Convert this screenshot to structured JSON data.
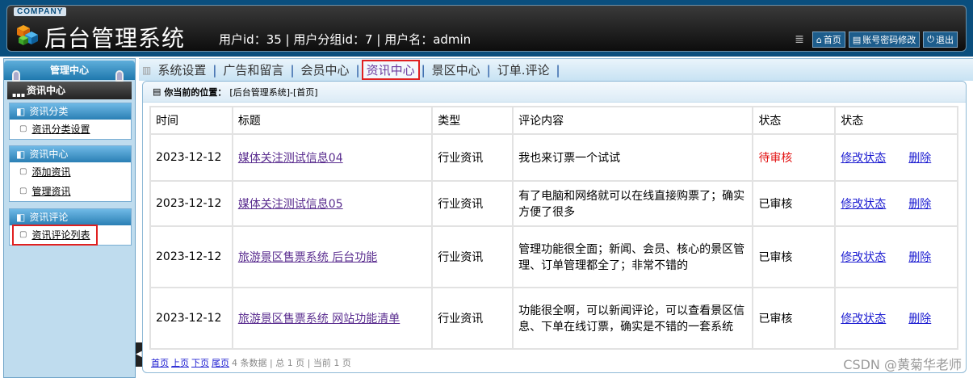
{
  "header": {
    "company": "COMPANY",
    "title": "后台管理系统",
    "user_info": "用户id：35 | 用户分组id：7 | 用户名：admin",
    "links": [
      {
        "label": "首页",
        "icon": "home-icon"
      },
      {
        "label": "账号密码修改",
        "icon": "document-icon"
      },
      {
        "label": "退出",
        "icon": "power-icon"
      }
    ]
  },
  "sidebar": {
    "head": "管理中心",
    "current": "资讯中心",
    "groups": [
      {
        "title": "资讯分类",
        "items": [
          "资讯分类设置"
        ]
      },
      {
        "title": "资讯中心",
        "items": [
          "添加资讯",
          "管理资讯"
        ]
      },
      {
        "title": "资讯评论",
        "items": [
          "资讯评论列表"
        ]
      }
    ]
  },
  "nav": {
    "tabs": [
      "系统设置",
      "广告和留言",
      "会员中心",
      "资讯中心",
      "景区中心",
      "订单.评论"
    ],
    "active_index": 3
  },
  "breadcrumb": {
    "label": "你当前的位置：",
    "path": "[后台管理系统]-[首页]"
  },
  "table": {
    "headers": [
      "时间",
      "标题",
      "类型",
      "评论内容",
      "状态",
      "状态"
    ],
    "rows": [
      {
        "time": "2023-12-12",
        "title": "媒体关注测试信息04",
        "type": "行业资讯",
        "comment": "我也来订票一个试试",
        "status": "待审核",
        "edit": "修改状态",
        "delete": "删除"
      },
      {
        "time": "2023-12-12",
        "title": "媒体关注测试信息05",
        "type": "行业资讯",
        "comment": "有了电脑和网络就可以在线直接购票了；确实方便了很多",
        "status": "已审核",
        "edit": "修改状态",
        "delete": "删除"
      },
      {
        "time": "2023-12-12",
        "title": "旅游景区售票系统 后台功能",
        "type": "行业资讯",
        "comment": "管理功能很全面；新闻、会员、核心的景区管理、订单管理都全了；非常不错的",
        "status": "已审核",
        "edit": "修改状态",
        "delete": "删除"
      },
      {
        "time": "2023-12-12",
        "title": "旅游景区售票系统 网站功能清单",
        "type": "行业资讯",
        "comment": "功能很全啊，可以新闻评论，可以查看景区信息、下单在线订票，确实是不错的一套系统",
        "status": "已审核",
        "edit": "修改状态",
        "delete": "删除"
      }
    ]
  },
  "pager": {
    "first": "首页",
    "prev": "上页",
    "next": "下页",
    "last": "尾页",
    "summary": "4 条数据 | 总 1 页 | 当前 1 页"
  },
  "watermark": "CSDN @黄菊华老师",
  "colors": {
    "header_bg": "#0a4e7d",
    "pending": "#e21212",
    "link": "#1d1dd1",
    "highlight": "#e02020"
  }
}
